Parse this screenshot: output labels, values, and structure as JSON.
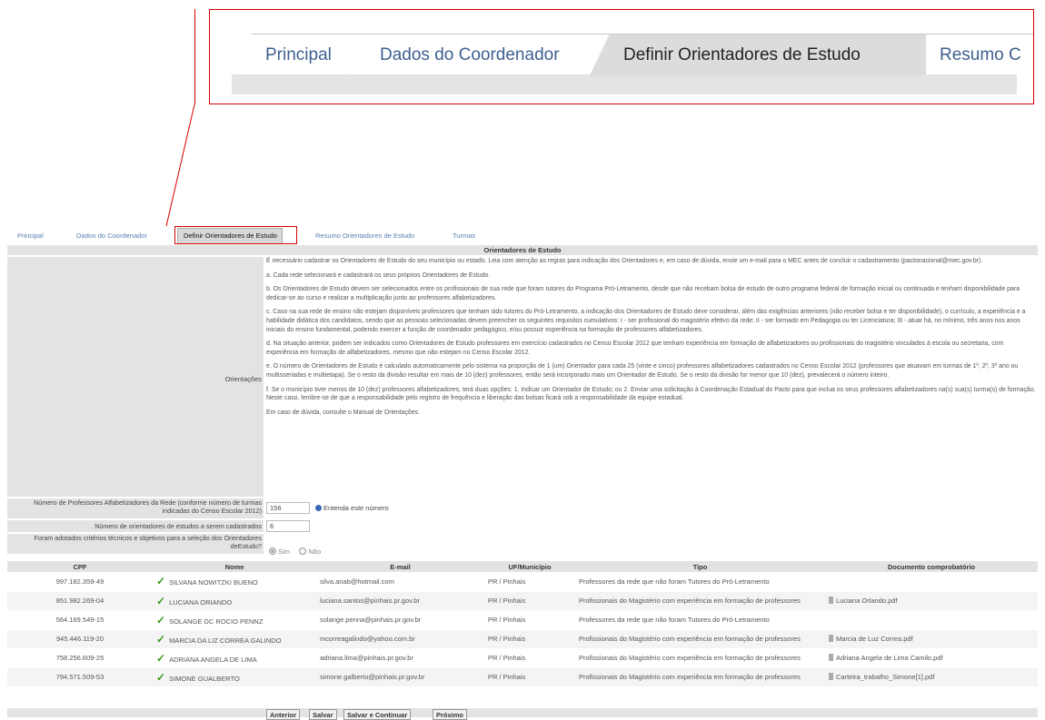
{
  "zoom_tabs": [
    {
      "label": "Principal",
      "active": false
    },
    {
      "label": "Dados do Coordenador",
      "active": false
    },
    {
      "label": "Definir Orientadores de Estudo",
      "active": true
    },
    {
      "label": "Resumo C",
      "active": false
    }
  ],
  "tabs": [
    {
      "label": "Principal",
      "active": false
    },
    {
      "label": "Dados do Coordenador",
      "active": false
    },
    {
      "label": "Definir Orientadores de Estudo",
      "active": true
    },
    {
      "label": "Resumo Orientadores de Estudo",
      "active": false
    },
    {
      "label": "Turmas",
      "active": false
    }
  ],
  "panel_title": "Orientadores de Estudo",
  "orientacoes": {
    "label": "Orientações",
    "paragraphs": [
      "É necessário cadastrar os Orientadores de Estudo do seu município ou estado. Leia com atenção as regras para indicação dos Orientadores e, em caso de dúvida, envie um e-mail para o MEC antes de concluir o cadastramento (pactonacional@mec.gov.br).",
      "a. Cada rede selecionará e cadastrará os seus próprios Orientadores de Estudo.",
      "b. Os Orientadores de Estudo devem ser selecionados entre os profissionais de sua rede que foram tutores do Programa Pró-Letramento, desde que não recebam bolsa de estudo de outro programa federal de formação inicial ou continuada e tenham disponibilidade para dedicar-se ao curso e realizar a multiplicação junto ao professores alfabetizadores.",
      "c. Caso na sua rede de ensino não estejam disponíveis professores que tenham sido tutores do Pró-Letramento, a indicação dos Orientadores de Estudo deve considerar, além das exigências anteriores (não receber bolsa e ter disponibilidade), o currículo, a experiência e a habilidade didática dos candidatos, sendo que as pessoas selecionadas devem preencher os seguintes requisitos cumulativos: I - ser profissional do magistério efetivo da rede; II - ser formado em Pedagogia ou ter Licenciatura; III - atuar há, no mínimo, três anos nos anos iniciais do ensino fundamental, podendo exercer a função de coordenador pedagógico, e/ou possuir experiência na formação de professores alfabetizadores.",
      "d. Na situação anterior, podem ser indicados como Orientadores de Estudo professores em exercício cadastrados no Censo Escolar 2012 que tenham experiência em formação de alfabetizadores ou profissionais do magistério vinculados à escola ou secretaria, com experiência em formação de alfabetizadores, mesmo que não estejam no Censo Escolar 2012.",
      "e. O número de Orientadores de Estudo é calculado automaticamente pelo sistema na proporção de 1 (um) Orientador para cada 25 (vinte e cinco) professores alfabetizadores cadastrados no Censo Escolar 2012 (professores que atuavam em turmas de 1º, 2º, 3º ano ou multisseriadas e multietapa). Se o resto da divisão resultar em mais de 10 (dez) professores, então será incorporado mais um Orientador de Estudo. Se o resto da divisão for menor que 10 (dez), prevalecerá o número inteiro.",
      "f. Se o município tiver menos de 10 (dez) professores alfabetizadores, terá duas opções: 1. Indicar um Orientador de Estudo; ou 2. Enviar uma solicitação à Coordenação Estadual do Pacto para que inclua os seus professores alfabetizadores na(s) sua(s) turma(s) de formação. Neste caso, lembre-se de que a responsabilidade pelo registro de frequência e liberação das bolsas ficará sob a responsabilidade da equipe estadual.",
      "Em caso de dúvida, consulte o Manual de Orientações."
    ]
  },
  "form": {
    "num_professores_label": "Número de Professores Alfabetizadores da Rede (conforme número de turmas indicadas do Censo Escolar 2012)",
    "num_professores_value": "156",
    "entenda_label": "Entenda este número",
    "num_orientadores_label": "Número de orientadores de estudos a serem cadastrados",
    "num_orientadores_value": "6",
    "criterios_label": "Foram adotados critérios técnicos e objetivos para a seleção dos Orientadores deEstudo?",
    "sim_label": "Sim",
    "nao_label": "Não"
  },
  "table": {
    "headers": [
      "CPF",
      "Nome",
      "E-mail",
      "UF/Município",
      "Tipo",
      "Documento comprobatório"
    ],
    "rows": [
      {
        "cpf": "997.182.359-49",
        "nome": "SILVANA NOWITZKI BUENO",
        "email": "silva.anab@hotmail.com",
        "uf": "PR / Pinhais",
        "tipo": "Professores da rede que não foram Tutores do Pró-Letramento",
        "doc": ""
      },
      {
        "cpf": "851.982.269-04",
        "nome": "LUCIANA ORIANDO",
        "email": "luciana.santos@pinhais.pr.gov.br",
        "uf": "PR / Pinhais",
        "tipo": "Profissionais do Magistério com experiência em formação de professores",
        "doc": "Luciana Orlando.pdf"
      },
      {
        "cpf": "564.169.549-15",
        "nome": "SOLANGE DC ROCIO PENNZ",
        "email": "solange.penna@pinhais.pr.gov.br",
        "uf": "PR / Pinhais",
        "tipo": "Professores da rede que não foram Tutores do Pró-Letramento",
        "doc": ""
      },
      {
        "cpf": "945.446.119-20",
        "nome": "MARCIA DA LIZ CORREA GALINDO",
        "email": "mcorreagalindo@yahoo.com.br",
        "uf": "PR / Pinhais",
        "tipo": "Profissionais do Magistério com experiência em formação de professores",
        "doc": "Marcia de Luz Correa.pdf"
      },
      {
        "cpf": "758.256.609-25",
        "nome": "ADRIANA ANGELA DE LIMA",
        "email": "adriana.lima@pinhais.pr.gov.br",
        "uf": "PR / Pinhais",
        "tipo": "Profissionais do Magistério com experiência em formação de professores",
        "doc": "Adriana Angela de Lima Camilo.pdf"
      },
      {
        "cpf": "794.571.509-53",
        "nome": "SIMONE GUALBERTO",
        "email": "simone.galberto@pinhais.pr.gov.br",
        "uf": "PR / Pinhais",
        "tipo": "Profissionais do Magistério com experiência em formação de professores",
        "doc": "Carteira_trabalho_Simone[1].pdf"
      }
    ]
  },
  "buttons": {
    "anterior": "Anterior",
    "salvar": "Salvar",
    "salvar_continuar": "Salvar e Continuar",
    "proximo": "Próximo"
  },
  "colors": {
    "highlight": "#d40000",
    "tab_text": "#5a7fb0",
    "check": "#3a9a1c"
  },
  "icons": [
    "check-icon",
    "info-icon",
    "document-icon"
  ]
}
